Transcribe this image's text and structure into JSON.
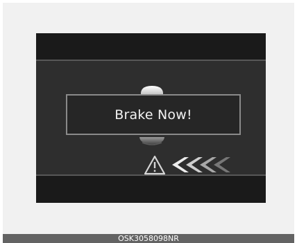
{
  "display": {
    "alert_message": "Brake Now!"
  },
  "icons": {
    "vehicle": "vehicle-ahead-icon",
    "warning": "warning-triangle-icon",
    "approach": "approach-chevrons-icon"
  },
  "colors": {
    "display_background": "#2e2e2e",
    "bezel": "#1a1a1a",
    "alert_border": "#8a8a8a",
    "alert_text": "#f2f2f2",
    "caption_background": "#636363"
  },
  "caption": {
    "code": "OSK3058098NR"
  }
}
